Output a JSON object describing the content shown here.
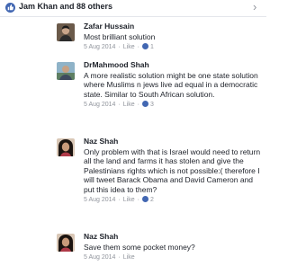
{
  "header": {
    "title": "Jam Khan and 88 others",
    "icon": "like-icon",
    "chevron": "›"
  },
  "comments": [
    {
      "name": "Zafar Hussain",
      "text": "Most brilliant solution",
      "date": "5 Aug 2014",
      "like_label": "Like",
      "likes": "1"
    },
    {
      "name": "DrMahmood Shah",
      "text": "A more realistic solution might be one state solution where Muslims n jews live ad equal in a democratic state.  Similar to South African solution.",
      "date": "5 Aug 2014",
      "like_label": "Like",
      "likes": "3"
    },
    {
      "name": "Naz Shah",
      "text": "Only problem with that is Israel would need to return all the land and farms it has stolen and give the Palestinians rights which is not possible:( therefore I will tweet Barack Obama and David Cameron and  put this idea to them?",
      "date": "5 Aug 2014",
      "like_label": "Like",
      "likes": "2"
    },
    {
      "name": "Naz Shah",
      "text": "Save them some pocket money?",
      "date": "5 Aug 2014",
      "like_label": "Like",
      "likes": ""
    }
  ],
  "colors": {
    "accent": "#4267b2",
    "meta": "#90949c",
    "text": "#1d2129"
  }
}
